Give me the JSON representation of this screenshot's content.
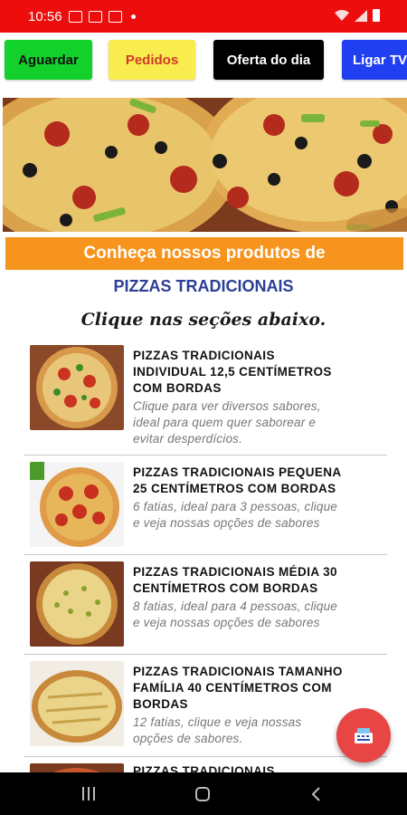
{
  "status_bar": {
    "time": "10:56"
  },
  "toolbar": {
    "buttons": [
      {
        "label": "Aguardar",
        "bg": "#12d12b",
        "fg": "#111111"
      },
      {
        "label": "Pedidos",
        "bg": "#f8ec4e",
        "fg": "#d23a2a"
      },
      {
        "label": "Oferta do dia",
        "bg": "#000000",
        "fg": "#ffffff"
      },
      {
        "label": "Ligar TV",
        "bg": "#1f3ff0",
        "fg": "#ffffff"
      }
    ]
  },
  "banner": {
    "icon": "pizza-banner-image"
  },
  "heading": {
    "orange_bar": "Conheça nossos produtos de",
    "category": "PIZZAS TRADICIONAIS",
    "hint": "Clique nas seções abaixo."
  },
  "products": [
    {
      "title_lines": [
        "PIZZAS  TRADICIONAIS",
        "INDIVIDUAL 12,5 CENTÍMETROS",
        "COM BORDAS"
      ],
      "desc_lines": [
        "Clique para ver diversos  sabores,",
        "ideal para quem quer saborear e",
        "evitar  desperdícios."
      ]
    },
    {
      "title_lines": [
        "PIZZAS TRADICIONAIS PEQUENA",
        "25 CENTÍMETROS COM BORDAS"
      ],
      "desc_lines": [
        "6 fatias, ideal para 3 pessoas, clique",
        "e veja nossas opções  de  sabores"
      ]
    },
    {
      "title_lines": [
        "PIZZAS TRADICIONAIS MÉDIA  30",
        "CENTÍMETROS COM BORDAS"
      ],
      "desc_lines": [
        "8 fatias, ideal para 4 pessoas, clique",
        "e veja nossas opções  de  sabores"
      ]
    },
    {
      "title_lines": [
        "PIZZAS TRADICIONAIS TAMANHO",
        "FAMÍLIA 40 CENTÍMETROS  COM",
        "BORDAS"
      ],
      "desc_lines": [
        "12 fatias,  clique  e veja nossas",
        "opções  de  sabores."
      ]
    },
    {
      "title_lines": [
        "PIZZAS  TRADICIONAIS"
      ],
      "desc_lines": []
    }
  ],
  "fab": {
    "icon": "cash-register-icon",
    "color": "#e84545"
  },
  "accent": {
    "status_red": "#ee0d0d",
    "orange": "#f7941d",
    "category_blue": "#2c3e97"
  }
}
